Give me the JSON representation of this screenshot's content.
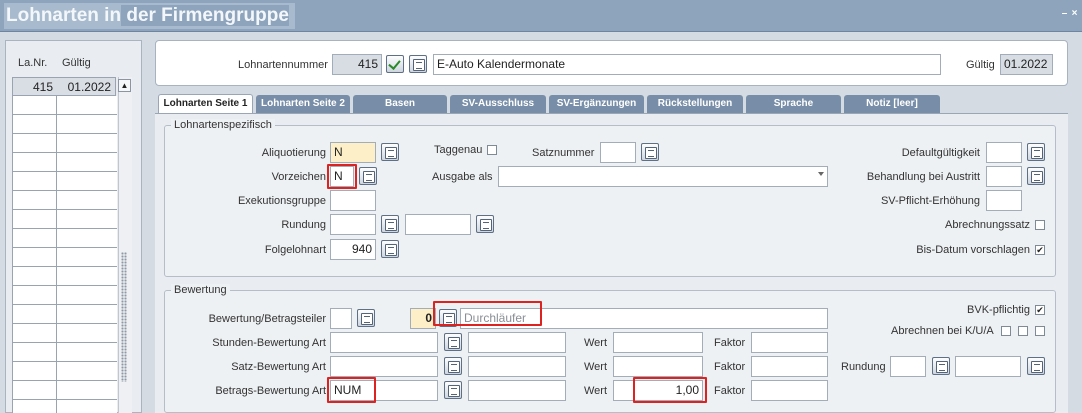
{
  "window": {
    "title_part1": "Lohnarten in",
    "title_part2": " der Firmengruppe",
    "minimize_glyph": "–",
    "close_glyph": "×"
  },
  "left_list": {
    "col_nr": "La.Nr.",
    "col_gueltig": "Gültig",
    "selected_nr": "415",
    "selected_gueltig": "01.2022",
    "scroll_up_glyph": "▲"
  },
  "header": {
    "lohnartennummer_label": "Lohnartennummer",
    "lohnartennummer_value": "415",
    "name_value": "E-Auto Kalendermonate",
    "gueltig_label": "Gültig",
    "gueltig_value": "01.2022"
  },
  "tabs": [
    {
      "label": "Lohnarten Seite 1",
      "active": true
    },
    {
      "label": "Lohnarten Seite 2"
    },
    {
      "label": "Basen"
    },
    {
      "label": "SV-Ausschluss"
    },
    {
      "label": "SV-Ergänzungen"
    },
    {
      "label": "Rückstellungen"
    },
    {
      "label": "Sprache"
    },
    {
      "label": "Notiz [leer]"
    }
  ],
  "spezifisch": {
    "title": "Lohnartenspezifisch",
    "aliquotierung_label": "Aliquotierung",
    "aliquotierung_value": "N",
    "taggenau_label": "Taggenau",
    "satznummer_label": "Satznummer",
    "satznummer_value": "",
    "defaultgueltigkeit_label": "Defaultgültigkeit",
    "vorzeichen_label": "Vorzeichen",
    "vorzeichen_value": "N",
    "ausgabe_als_label": "Ausgabe als",
    "ausgabe_als_value": "",
    "behandlung_label": "Behandlung bei Austritt",
    "exekutionsgruppe_label": "Exekutionsgruppe",
    "sv_pflicht_label": "SV-Pflicht-Erhöhung",
    "rundung_label": "Rundung",
    "abrechnungssatz_label": "Abrechnungssatz",
    "abrechnungssatz_checked": false,
    "folgelohnart_label": "Folgelohnart",
    "folgelohnart_value": "940",
    "bis_datum_label": "Bis-Datum vorschlagen",
    "bis_datum_checked": true,
    "check_glyph": "✔"
  },
  "bewertung": {
    "title": "Bewertung",
    "betragsteiler_label": "Bewertung/Betragsteiler",
    "betragsteiler_code": "0",
    "betragsteiler_placeholder": "Durchläufer",
    "bvk_label": "BVK-pflichtig",
    "bvk_checked": true,
    "stunden_label": "Stunden-Bewertung Art",
    "wert_label": "Wert",
    "faktor_label": "Faktor",
    "abrechnen_label": "Abrechnen bei K/U/A",
    "satz_label": "Satz-Bewertung Art",
    "rundung_label": "Rundung",
    "betrags_label": "Betrags-Bewertung Art",
    "betrags_art_value": "NUM",
    "betrags_wert_value": "1,00"
  },
  "colors": {
    "title_bar": "#8ea4bd",
    "tab_inactive": "#788ea8",
    "field_highlight": "#fdf0c8",
    "annotation_red": "#d22222"
  }
}
